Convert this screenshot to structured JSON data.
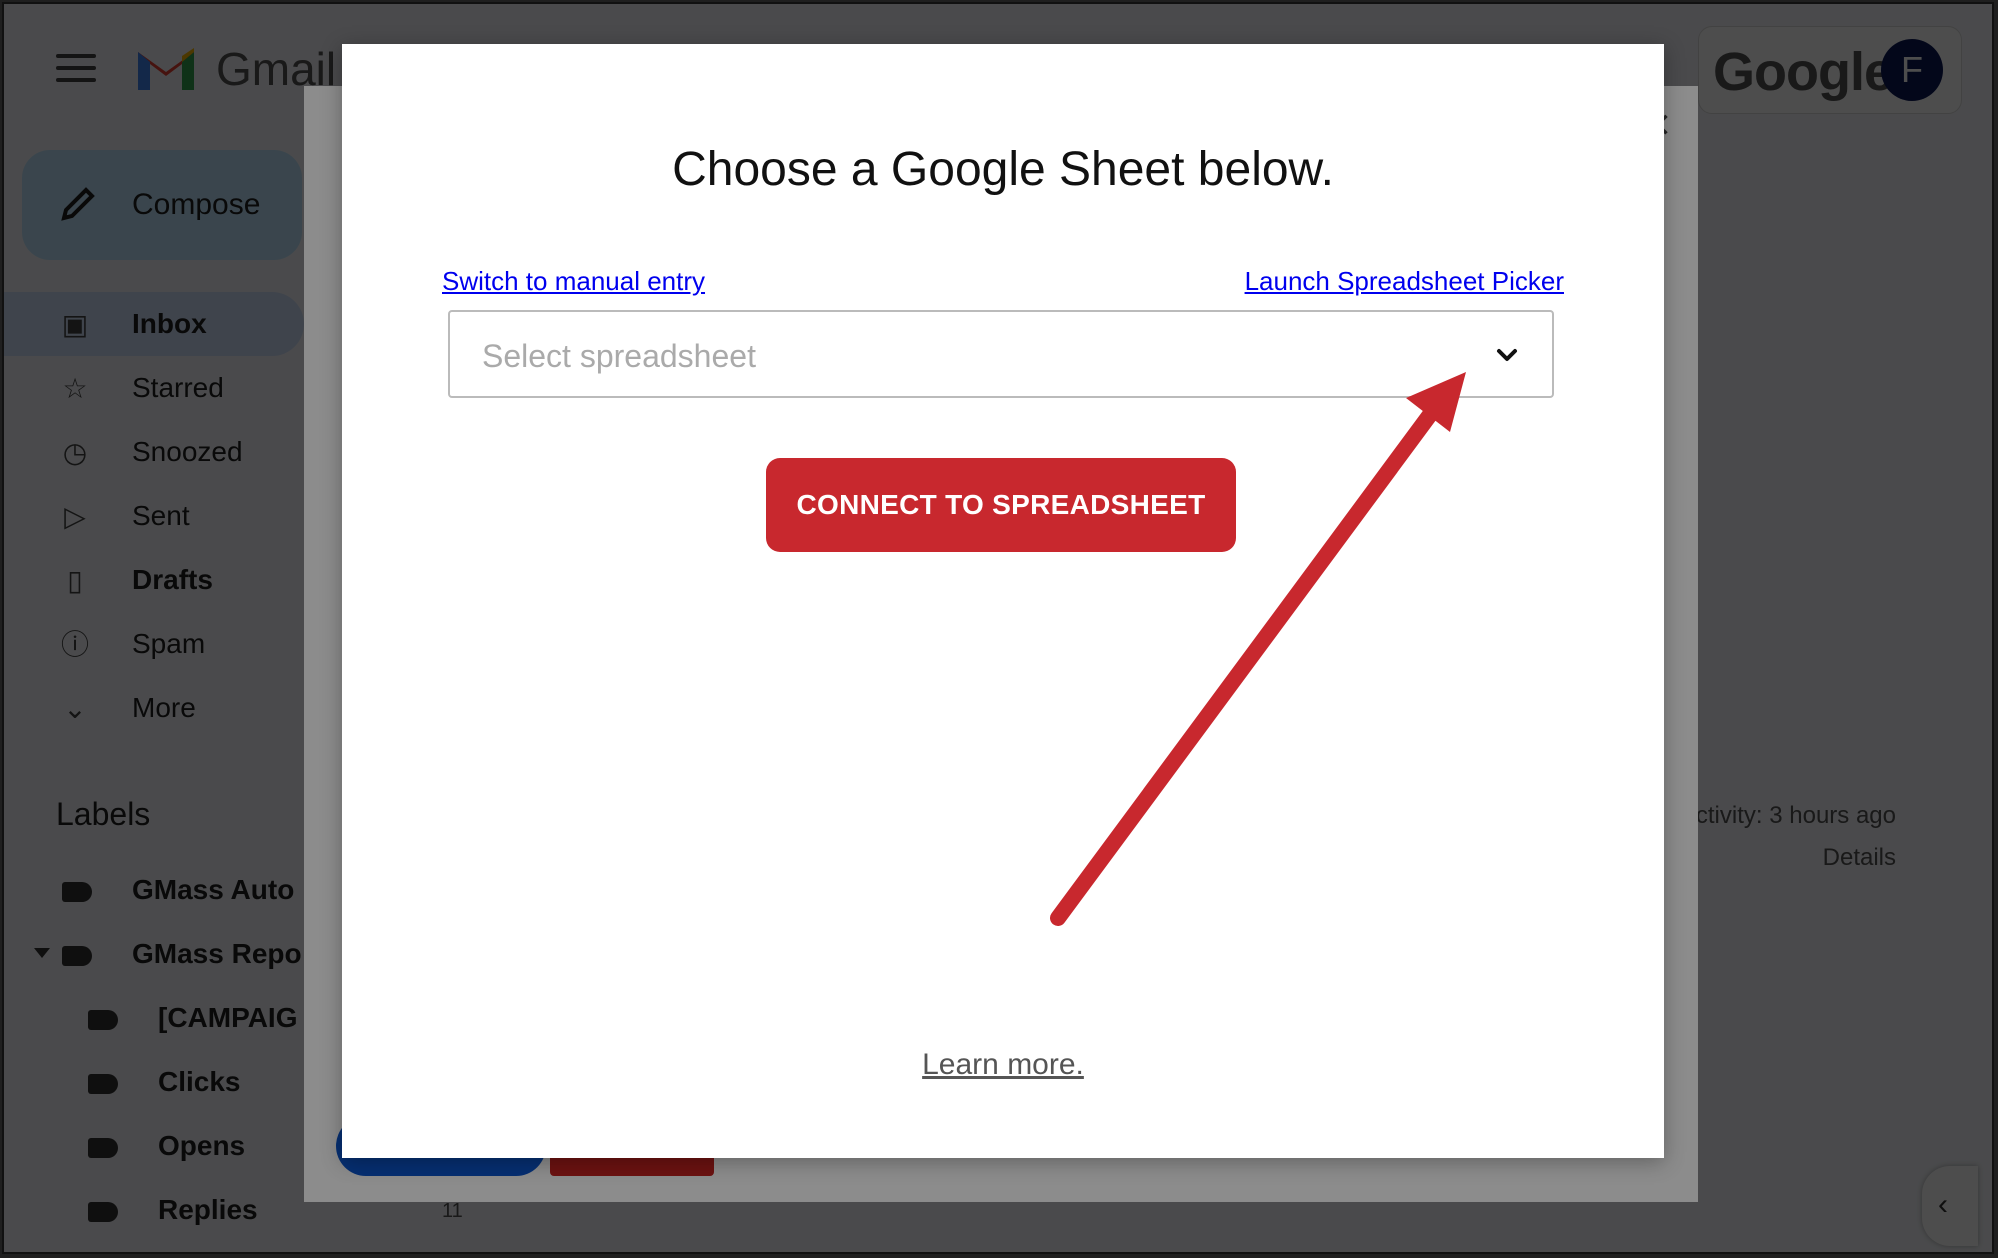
{
  "gmail": {
    "wordmark": "Gmail",
    "google_wordmark": "Google",
    "avatar_letter": "F",
    "compose_label": "Compose",
    "nav": [
      {
        "label": "Inbox",
        "icon": "inbox-icon",
        "bold": true
      },
      {
        "label": "Starred",
        "icon": "star-icon",
        "bold": false
      },
      {
        "label": "Snoozed",
        "icon": "clock-icon",
        "bold": false
      },
      {
        "label": "Sent",
        "icon": "send-icon",
        "bold": false
      },
      {
        "label": "Drafts",
        "icon": "draft-icon",
        "bold": true
      },
      {
        "label": "Spam",
        "icon": "spam-icon",
        "bold": false
      },
      {
        "label": "More",
        "icon": "chevron-down-icon",
        "bold": false
      }
    ],
    "labels_title": "Labels",
    "labels": [
      {
        "label": "GMass Auto"
      },
      {
        "label": "GMass Repo"
      },
      {
        "label": "[CAMPAIG"
      },
      {
        "label": "Clicks"
      },
      {
        "label": "Opens"
      },
      {
        "label": "Replies"
      }
    ],
    "activity": "ctivity: 3 hours ago",
    "details": "Details",
    "bottom_count": "11"
  },
  "modal": {
    "title": "Choose a Google Sheet below.",
    "manual_link": "Switch to manual entry",
    "picker_link": "Launch Spreadsheet Picker",
    "select_placeholder": "Select spreadsheet",
    "connect_button": "CONNECT TO SPREADSHEET",
    "learn_more": "Learn more."
  },
  "colors": {
    "connect_button": "#c8282e",
    "annotation_arrow": "#c8282e",
    "link": "#0000ee"
  }
}
